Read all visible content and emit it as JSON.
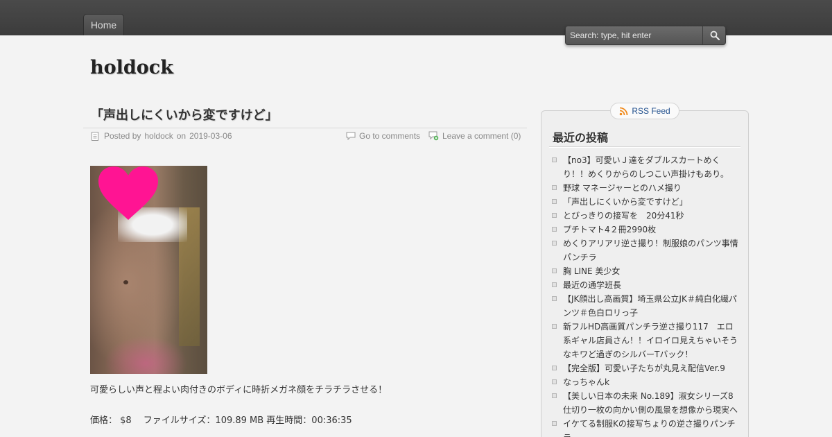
{
  "nav": {
    "home_label": "Home"
  },
  "search": {
    "placeholder": "Search: type, hit enter"
  },
  "site": {
    "title": "holdock"
  },
  "post": {
    "title": "「声出しにくいから変ですけど」",
    "meta": {
      "posted_by_prefix": "Posted by",
      "author": "holdock",
      "on": "on",
      "date": "2019-03-06",
      "comments_link": "Go to comments",
      "leave_comment": "Leave a comment (0)"
    },
    "body": "可愛らしい声と程よい肉付きのボディに時折メガネ顔をチラチラさせる！",
    "price_line": "価格： $8　 ファイルサイズ：109.89 MB 再生時間：00:36:35"
  },
  "sidebar": {
    "rss_label": "RSS Feed",
    "recent_title": "最近の投稿",
    "recent_posts": [
      "【no3】可愛いＪ達をダブルスカートめくり！！めくりからのしつこい声掛けもあり。",
      "野球 マネージャーとのハメ撮り",
      "「声出しにくいから変ですけど」",
      "とびっきりの接写を　20分41秒",
      "プチトマト4２冊2990枚",
      "めくりアリアリ逆さ撮り！制服娘のパンツ事情パンチラ",
      "胸 LINE 美少女",
      "最近の通学班長",
      "【JK顔出し高画質】埼玉県公立JK＃純白化繊パンツ＃色白ロリっ子",
      "新フルHD高画質パンチラ逆さ撮り117　エロ系ギャル店員さん！！イロイロ見えちゃいそうなキワど過ぎのシルバーTバック！",
      "【完全版】可愛い子たちが丸見え配信Ver.9",
      "なっちゃんk",
      "【美しい日本の未来 No.189】淑女シリーズ8　　仕切り一枚の向かい側の風景を想像から現実へ",
      "イケてる制服Kの接写ちょりの逆さ撮りパンチラ"
    ]
  },
  "colors": {
    "topbar": "#444444",
    "background": "#f3f3f3",
    "link": "#1f4e8c",
    "heart": "#ff1493"
  }
}
